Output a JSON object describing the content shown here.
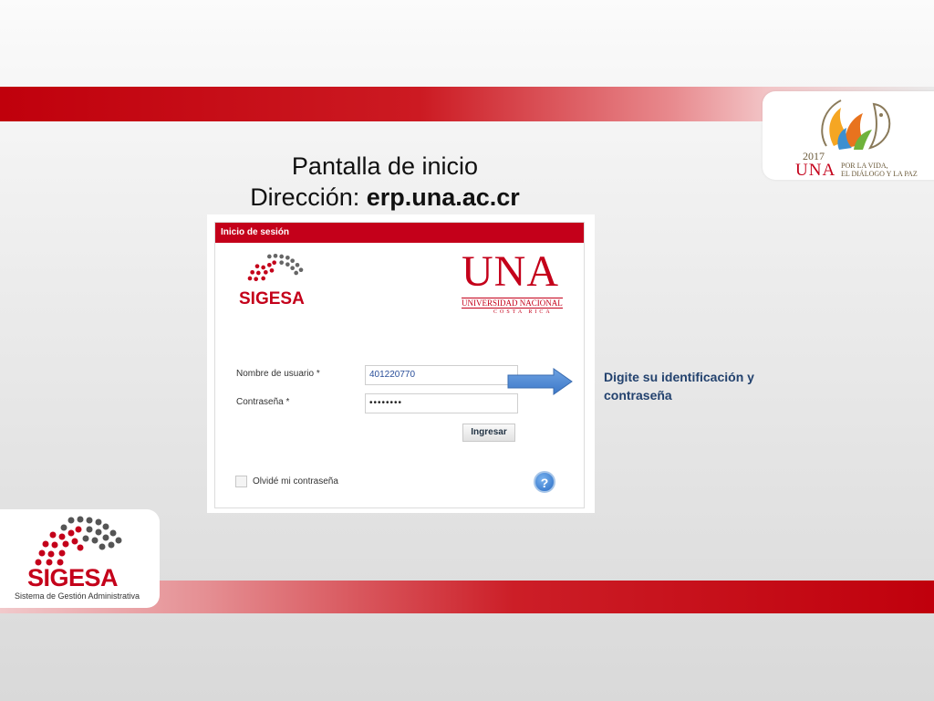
{
  "slide": {
    "title_line1": "Pantalla de inicio",
    "title_line2_prefix": "Dirección: ",
    "title_line2_url": "erp.una.ac.cr",
    "note": "Digite su identificación y contraseña"
  },
  "logo_top_right": {
    "year": "2017",
    "wordmark": "UNA",
    "tagline_line1": "POR LA VIDA,",
    "tagline_line2": "EL DIÁLOGO Y LA PAZ"
  },
  "logo_bottom_left": {
    "wordmark": "SIGESA",
    "subtitle": "Sistema de Gestión Administrativa"
  },
  "login": {
    "header": "Inicio de sesión",
    "sigesa_wordmark": "SIGESA",
    "una_wordmark": "UNA",
    "una_line1": "UNIVERSIDAD NACIONAL",
    "una_line2": "COSTA RICA",
    "username_label": "Nombre de usuario  *",
    "username_value": "401220770",
    "password_label": "Contraseña  *",
    "password_value": "••••••••",
    "submit_label": "Ingresar",
    "forgot_label": "Olvidé mi contraseña",
    "help_glyph": "?"
  },
  "colors": {
    "brand_red": "#c4001a",
    "note_blue": "#23426e",
    "arrow_blue": "#4a8ad6"
  },
  "icons": [
    "help-icon",
    "arrow-right-icon",
    "sigesa-dots-logo",
    "una-flame-logo"
  ]
}
